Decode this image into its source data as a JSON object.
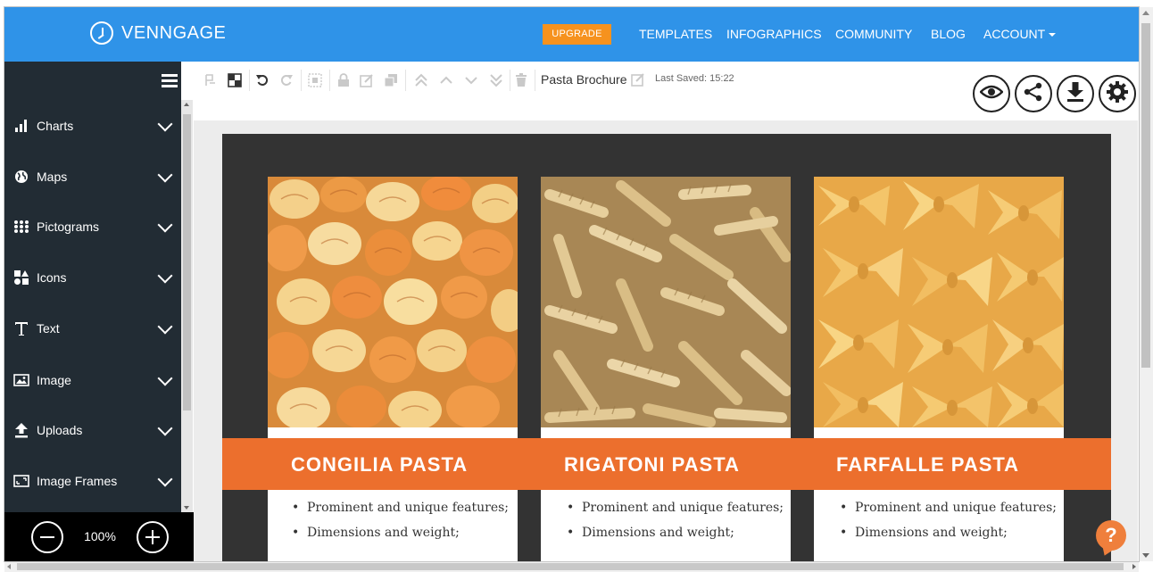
{
  "topnav": {
    "logo": "VENNGAGE",
    "upgrade": "UPGRADE",
    "links": [
      "TEMPLATES",
      "INFOGRAPHICS",
      "COMMUNITY",
      "BLOG",
      "ACCOUNT"
    ]
  },
  "sidebar": {
    "items": [
      {
        "label": "Charts",
        "icon": "bar-chart-icon"
      },
      {
        "label": "Maps",
        "icon": "globe-icon"
      },
      {
        "label": "Pictograms",
        "icon": "pictogram-grid-icon"
      },
      {
        "label": "Icons",
        "icon": "shapes-icon"
      },
      {
        "label": "Text",
        "icon": "text-icon"
      },
      {
        "label": "Image",
        "icon": "image-icon"
      },
      {
        "label": "Uploads",
        "icon": "upload-icon"
      },
      {
        "label": "Image Frames",
        "icon": "image-frame-icon"
      }
    ],
    "zoom": "100%"
  },
  "toolbar": {
    "doc_title": "Pasta Brochure",
    "last_saved": "Last Saved: 15:22"
  },
  "poster": {
    "colors": {
      "background": "#333333",
      "banner": "#ec6f2d"
    },
    "pastas": [
      {
        "name": "CONGILIA PASTA",
        "bullets": [
          "Prominent and unique features;",
          "Dimensions and weight;"
        ]
      },
      {
        "name": "RIGATONI PASTA",
        "bullets": [
          "Prominent and unique features;",
          "Dimensions and weight;"
        ]
      },
      {
        "name": "FARFALLE PASTA",
        "bullets": [
          "Prominent and unique features;",
          "Dimensions and weight;"
        ]
      }
    ]
  },
  "help": "?"
}
